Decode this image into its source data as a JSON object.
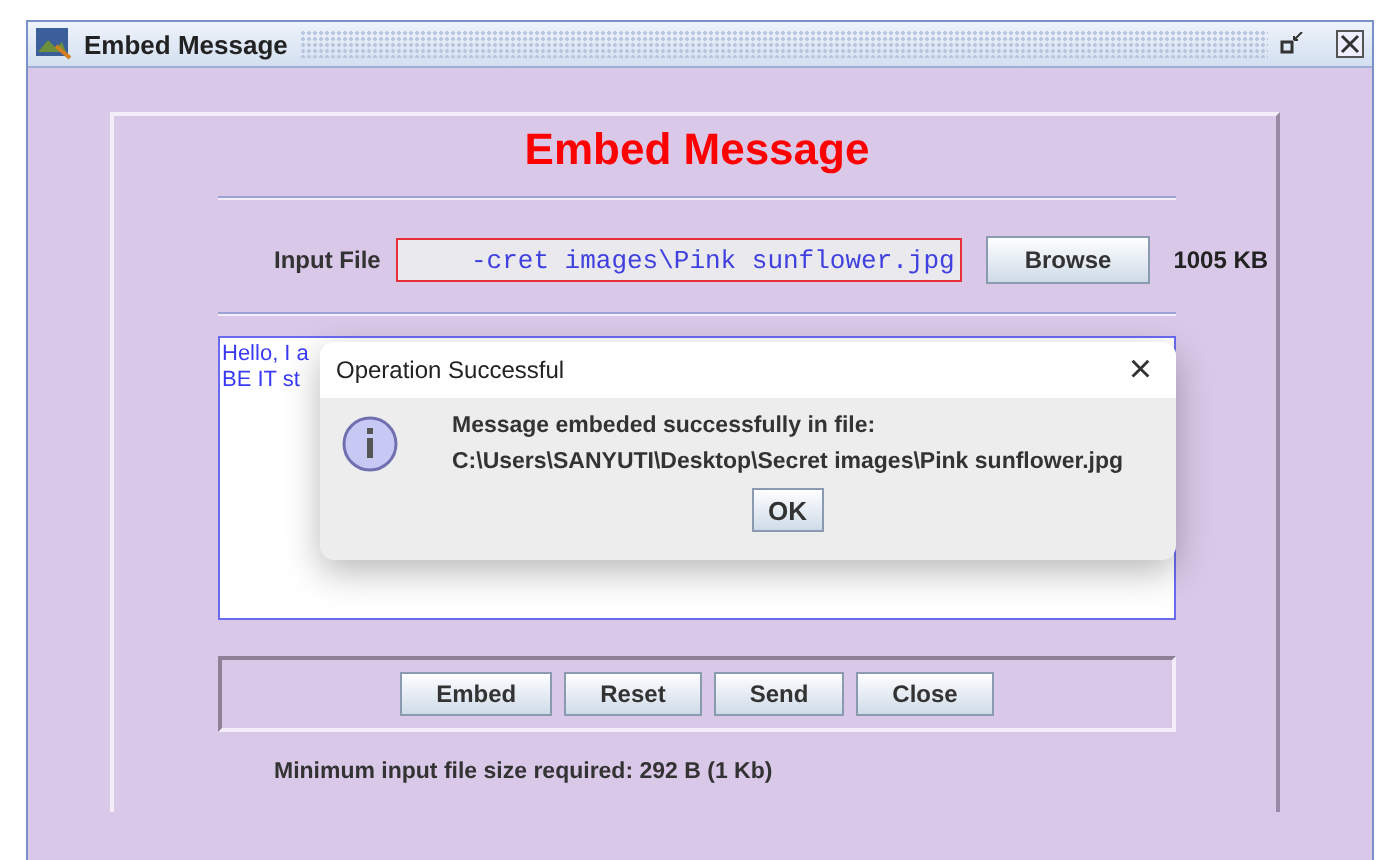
{
  "window": {
    "title": "Embed Message"
  },
  "heading": "Embed Message",
  "input_file": {
    "label": "Input File",
    "value": "-cret images\\Pink sunflower.jpg",
    "browse": "Browse",
    "size": "1005 KB"
  },
  "message_lines": [
    "Hello, I a",
    "BE IT st"
  ],
  "dialog": {
    "title": "Operation Successful",
    "close": "×",
    "message": "Message embeded successfully in file:",
    "path": "C:\\Users\\SANYUTI\\Desktop\\Secret images\\Pink sunflower.jpg",
    "button": "OK"
  },
  "buttons": [
    "Embed",
    "Reset",
    "Send",
    "Close"
  ],
  "status": "Minimum input file size required: 292 B (1 Kb)"
}
